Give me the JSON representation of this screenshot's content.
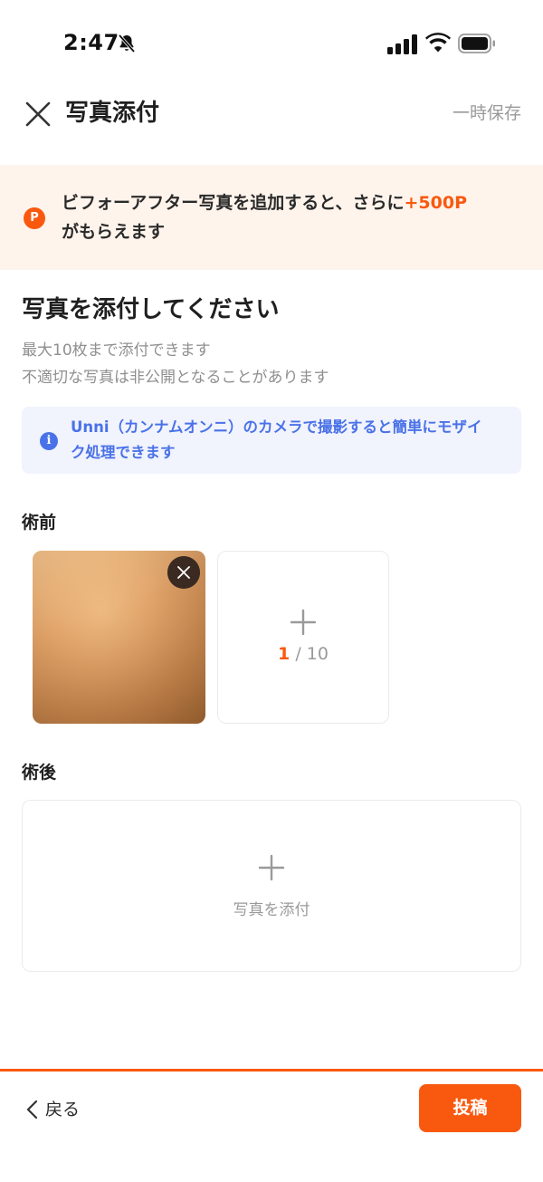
{
  "status_bar": {
    "time": "2:47",
    "icons": [
      "bell-slash-icon",
      "signal-icon",
      "wifi-icon",
      "battery-icon"
    ]
  },
  "header": {
    "title": "写真添付",
    "save_draft": "一時保存",
    "close_icon": "close-icon"
  },
  "banner": {
    "badge": "P",
    "text_before": "ビフォーアフター写真を追加すると、さらに",
    "highlight": "+500P",
    "text_after": "がもらえます"
  },
  "section": {
    "title": "写真を添付してください",
    "desc_line1": "最大10枚まで添付できます",
    "desc_line2": "不適切な写真は非公開となることがあります"
  },
  "info": {
    "icon": "i",
    "text": "Unni（カンナムオンニ）のカメラで撮影すると簡単にモザイク処理できます"
  },
  "before": {
    "label": "術前",
    "counter_current": "1",
    "counter_total": " / 10"
  },
  "after": {
    "label": "術後",
    "attach_label": "写真を添付"
  },
  "footer": {
    "back_label": "戻る",
    "post_label": "投稿"
  },
  "colors": {
    "accent": "#f9590f",
    "banner_bg": "#fff4ec",
    "info_bg": "#f1f3fd",
    "info_text": "#4a72e8"
  }
}
